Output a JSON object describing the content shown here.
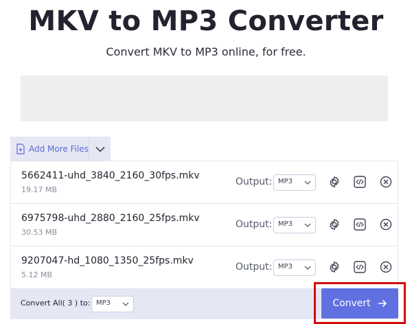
{
  "page": {
    "title": "MKV to MP3 Converter",
    "subtitle": "Convert MKV to MP3 online, for free."
  },
  "toolbar": {
    "add_more_label": "Add More Files"
  },
  "output_label": "Output:",
  "files": [
    {
      "name": "5662411-uhd_3840_2160_30fps.mkv",
      "size": "19.17 MB",
      "format": "MP3"
    },
    {
      "name": "6975798-uhd_2880_2160_25fps.mkv",
      "size": "30.53 MB",
      "format": "MP3"
    },
    {
      "name": "9207047-hd_1080_1350_25fps.mkv",
      "size": "5.12 MB",
      "format": "MP3"
    }
  ],
  "footer": {
    "convert_all_label": "Convert All( 3 ) to:",
    "convert_all_format": "MP3",
    "convert_button": "Convert"
  },
  "icons": [
    "file-plus-icon",
    "chevron-down-icon",
    "gear-icon",
    "code-icon",
    "close-circle-icon",
    "arrow-right-icon"
  ],
  "colors": {
    "accent": "#6170e1",
    "highlight": "#d40b0b",
    "toolbar_bg": "#e5e8f4"
  }
}
